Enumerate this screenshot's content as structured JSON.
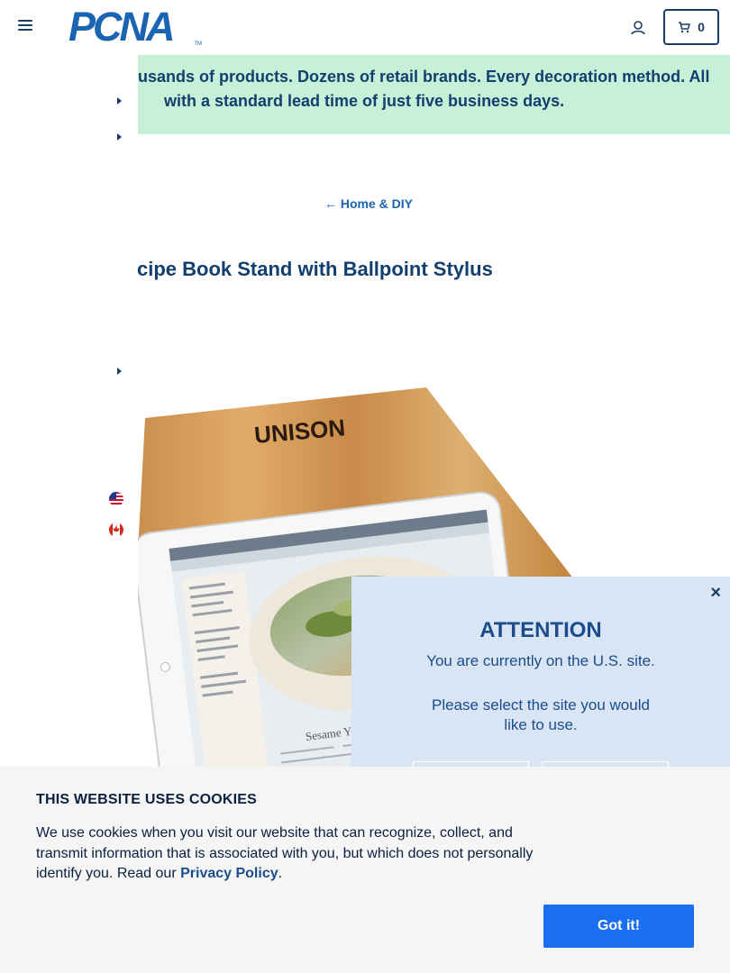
{
  "header": {
    "logo_text": "PCNA",
    "logo_tm": "TM",
    "cart_count": "0"
  },
  "promo": {
    "line1": "usands of products. Dozens of retail brands. Every decoration method. All",
    "line2": "with a standard lead time of just five business days."
  },
  "breadcrumb": {
    "arrow": "←",
    "label": "Home & DIY"
  },
  "product": {
    "title": "cipe Book Stand with Ballpoint Stylus",
    "board_brand": "UNISON",
    "screen_caption": "Sesame Yo"
  },
  "site_popup": {
    "close": "×",
    "title": "ATTENTION",
    "line1": "You are currently on the U.S. site.",
    "line2": "Please select the site you would",
    "line3": "like to use."
  },
  "cookie": {
    "title": "THIS WEBSITE USES COOKIES",
    "text_before": "We use cookies when you visit our website that can recognize, collect, and transmit information that is associated with you, but which does not personally identify you. Read our ",
    "link": "Privacy Policy",
    "text_after": ".",
    "button": "Got it!"
  },
  "colors": {
    "brand_blue": "#1a64b1",
    "navy": "#123f6d",
    "promo_bg": "#c7f0d8",
    "popup_bg": "#d9e4f5",
    "cookie_button": "#1a6ef0"
  },
  "icons": [
    "menu-icon",
    "account-icon",
    "cart-icon",
    "chevron-right-icon",
    "us-flag-icon",
    "canada-flag-icon",
    "close-icon",
    "arrow-left-icon"
  ]
}
